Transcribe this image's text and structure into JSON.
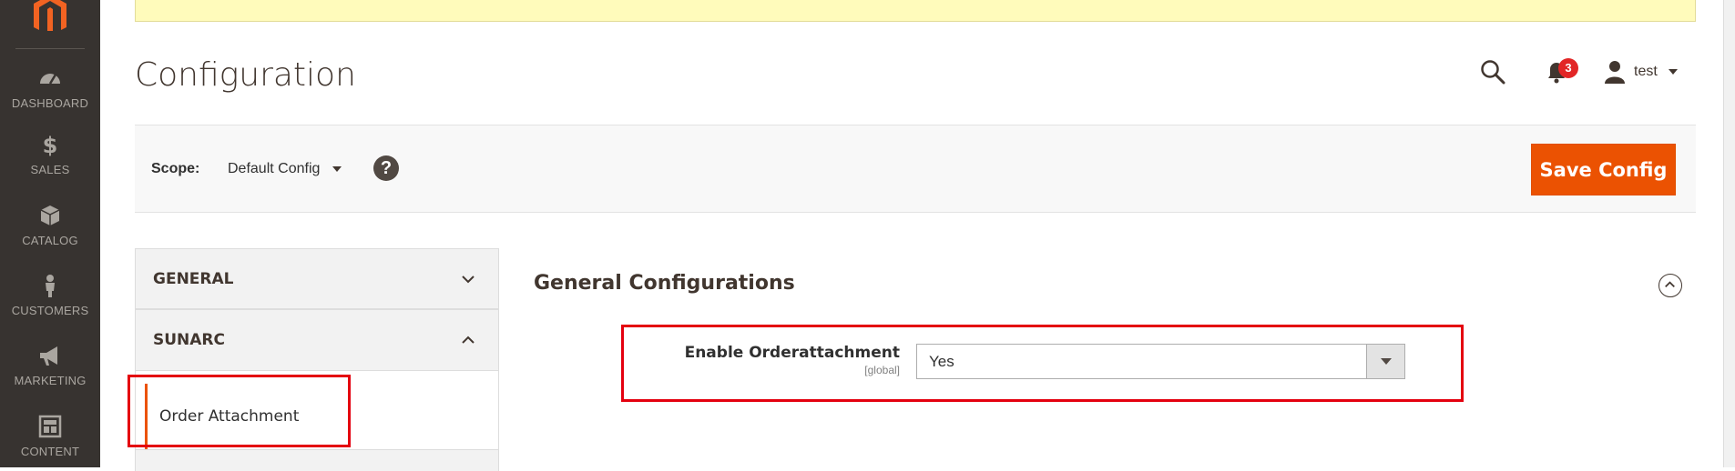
{
  "sidebar": {
    "items": [
      {
        "label": "DASHBOARD",
        "icon": "dashboard-icon"
      },
      {
        "label": "SALES",
        "icon": "dollar-icon"
      },
      {
        "label": "CATALOG",
        "icon": "box-icon"
      },
      {
        "label": "CUSTOMERS",
        "icon": "person-icon"
      },
      {
        "label": "MARKETING",
        "icon": "megaphone-icon"
      },
      {
        "label": "CONTENT",
        "icon": "layout-icon"
      }
    ]
  },
  "header": {
    "title": "Configuration",
    "notifications_count": "3",
    "user_name": "test"
  },
  "scope": {
    "label": "Scope:",
    "value": "Default Config",
    "help": "?"
  },
  "toolbar": {
    "save_label": "Save Config"
  },
  "left_nav": {
    "tabs": [
      {
        "label": "GENERAL",
        "expanded": false
      },
      {
        "label": "SUNARC",
        "expanded": true
      }
    ],
    "sub_items": [
      {
        "label": "Order Attachment",
        "active": true
      }
    ]
  },
  "section": {
    "title": "General Configurations",
    "field": {
      "label": "Enable Orderattachment",
      "scope": "[global]",
      "value": "Yes"
    }
  },
  "colors": {
    "accent": "#eb5202",
    "sidebar_bg": "#373330",
    "highlight": "#e4000f",
    "notice_bg": "#fffbbb"
  }
}
